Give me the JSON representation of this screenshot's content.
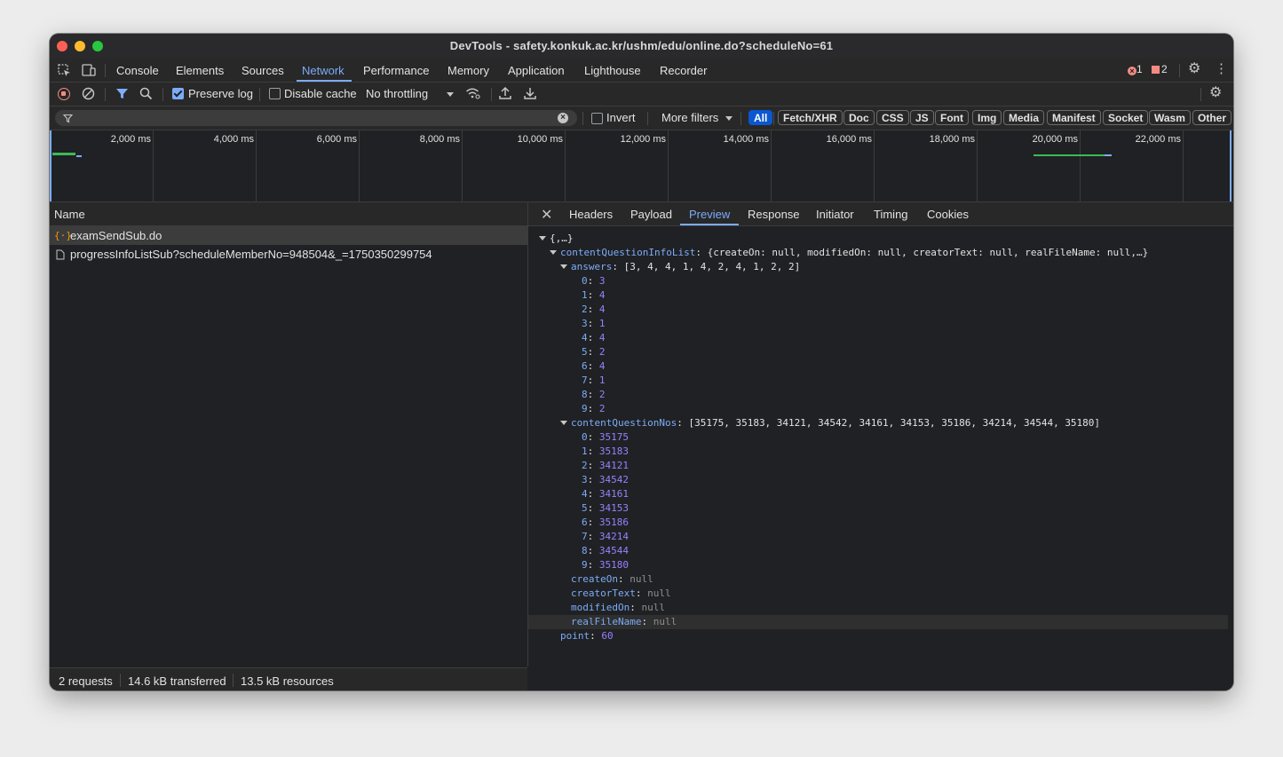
{
  "window": {
    "title": "DevTools - safety.konkuk.ac.kr/ushm/edu/online.do?scheduleNo=61"
  },
  "main_tabs": [
    "Console",
    "Elements",
    "Sources",
    "Network",
    "Performance",
    "Memory",
    "Application",
    "Lighthouse",
    "Recorder"
  ],
  "active_main_tab": "Network",
  "badges": {
    "errors": "1",
    "issues": "2"
  },
  "toolbar": {
    "preserve_log": "Preserve log",
    "disable_cache": "Disable cache",
    "throttling": "No throttling"
  },
  "filter": {
    "invert": "Invert",
    "more_filters": "More filters"
  },
  "type_filters": [
    "All",
    "Fetch/XHR",
    "Doc",
    "CSS",
    "JS",
    "Font",
    "Img",
    "Media",
    "Manifest",
    "Socket",
    "Wasm",
    "Other"
  ],
  "timeline_ticks": [
    "2,000 ms",
    "4,000 ms",
    "6,000 ms",
    "8,000 ms",
    "10,000 ms",
    "12,000 ms",
    "14,000 ms",
    "16,000 ms",
    "18,000 ms",
    "20,000 ms",
    "22,000 ms"
  ],
  "requests": {
    "header": "Name",
    "items": [
      {
        "name": "examSendSub.do"
      },
      {
        "name": "progressInfoListSub?scheduleMemberNo=948504&_=1750350299754"
      }
    ]
  },
  "status": {
    "requests": "2 requests",
    "transferred": "14.6 kB transferred",
    "resources": "13.5 kB resources"
  },
  "detail_tabs": [
    "Headers",
    "Payload",
    "Preview",
    "Response",
    "Initiator",
    "Timing",
    "Cookies"
  ],
  "active_detail_tab": "Preview",
  "preview": {
    "root": "{,…}",
    "info_key": "contentQuestionInfoList",
    "info_summary": "{createOn: null, modifiedOn: null, creatorText: null, realFileName: null,…}",
    "answers_key": "answers",
    "answers_summary": "[3, 4, 4, 1, 4, 2, 4, 1, 2, 2]",
    "answers": [
      "3",
      "4",
      "4",
      "1",
      "4",
      "2",
      "4",
      "1",
      "2",
      "2"
    ],
    "nos_key": "contentQuestionNos",
    "nos_summary": "[35175, 35183, 34121, 34542, 34161, 34153, 35186, 34214, 34544, 35180]",
    "nos": [
      "35175",
      "35183",
      "34121",
      "34542",
      "34161",
      "34153",
      "35186",
      "34214",
      "34544",
      "35180"
    ],
    "props": [
      {
        "key": "createOn",
        "value": "null"
      },
      {
        "key": "creatorText",
        "value": "null"
      },
      {
        "key": "modifiedOn",
        "value": "null"
      },
      {
        "key": "realFileName",
        "value": "null"
      }
    ],
    "point_key": "point",
    "point_value": "60"
  }
}
